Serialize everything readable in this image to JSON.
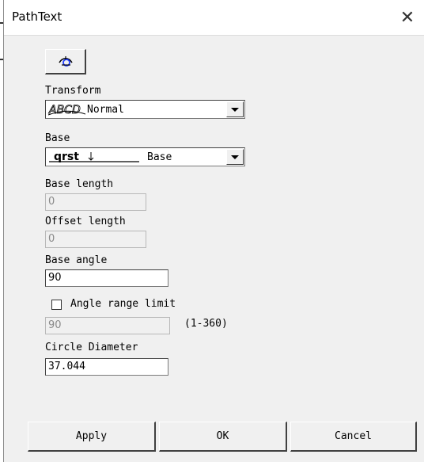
{
  "window": {
    "title": "PathText",
    "close_glyph": "✕"
  },
  "toolbar": {
    "icon": "path-text-icon"
  },
  "transform": {
    "label": "Transform",
    "preview_text": "ABCD",
    "selected": "Normal"
  },
  "base": {
    "label": "Base",
    "preview_text": "qrst",
    "selected": "Base"
  },
  "base_length": {
    "label": "Base length",
    "value": "0"
  },
  "offset_length": {
    "label": "Offset length",
    "value": "0"
  },
  "base_angle": {
    "label": "Base angle",
    "value": "90"
  },
  "angle_limit": {
    "label": "Angle range limit",
    "checked": false,
    "value": "90",
    "range_hint": "(1-360)"
  },
  "circle_diameter": {
    "label": "Circle Diameter",
    "value": "37.044"
  },
  "buttons": {
    "apply": "Apply",
    "ok": "OK",
    "cancel": "Cancel"
  }
}
